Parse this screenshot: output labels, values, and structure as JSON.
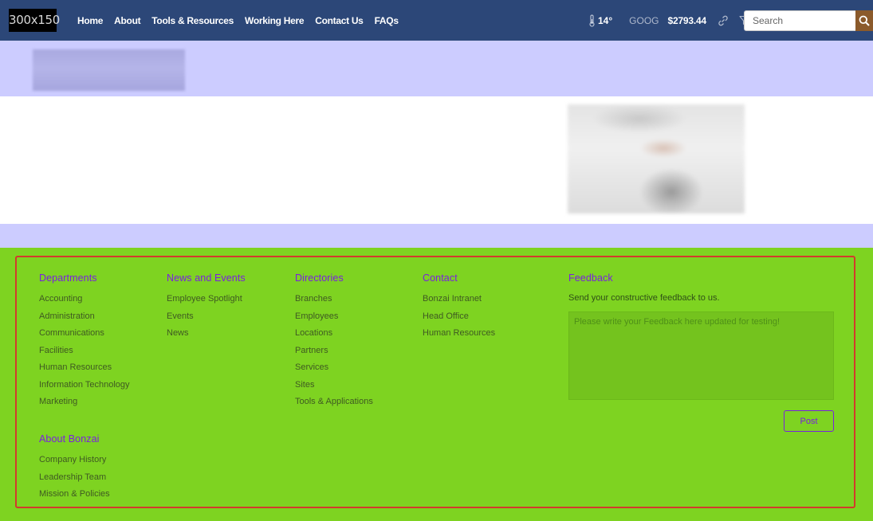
{
  "header": {
    "logo_text": "300x150",
    "nav": [
      "Home",
      "About",
      "Tools & Resources",
      "Working Here",
      "Contact Us",
      "FAQs"
    ],
    "weather": {
      "icon": "thermometer-icon",
      "temperature": "14°"
    },
    "stock": {
      "symbol": "GOOG",
      "price": "$2793.44"
    },
    "search": {
      "placeholder": "Search"
    }
  },
  "colors": {
    "nav_bg": "#2c4778",
    "band": "#ccccff",
    "footer_bg": "#7ed321",
    "heading": "#7a1fe0",
    "frame": "#d33a2c",
    "search_button": "#8b5a2b"
  },
  "footer": {
    "departments": {
      "title": "Departments",
      "items": [
        "Accounting",
        "Administration",
        "Communications",
        "Facilities",
        "Human Resources",
        "Information Technology",
        "Marketing"
      ]
    },
    "news": {
      "title": "News and Events",
      "items": [
        "Employee Spotlight",
        "Events",
        "News"
      ]
    },
    "directories": {
      "title": "Directories",
      "items": [
        "Branches",
        "Employees",
        "Locations",
        "Partners",
        "Services",
        "Sites",
        "Tools & Applications"
      ]
    },
    "contact": {
      "title": "Contact",
      "items": [
        "Bonzai Intranet",
        "Head Office",
        "Human Resources"
      ]
    },
    "about": {
      "title": "About Bonzai",
      "items": [
        "Company History",
        "Leadership Team",
        "Mission & Policies"
      ]
    },
    "feedback": {
      "title": "Feedback",
      "description": "Send your constructive feedback to us.",
      "placeholder": "Please write your Feedback here updated for testing!",
      "button": "Post"
    }
  }
}
